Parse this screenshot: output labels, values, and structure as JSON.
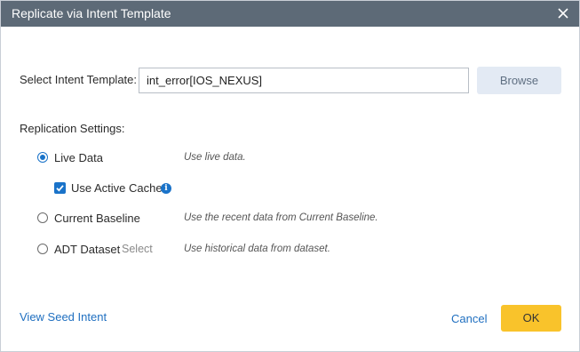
{
  "dialog": {
    "title": "Replicate via Intent Template",
    "close_icon": "close-icon"
  },
  "template": {
    "label": "Select Intent Template:",
    "value": "int_error[IOS_NEXUS]",
    "browse_label": "Browse"
  },
  "replication": {
    "heading": "Replication Settings:",
    "options": [
      {
        "label": "Live Data",
        "description": "Use live data.",
        "selected": true
      },
      {
        "label": "Current Baseline",
        "description": "Use the recent data from Current Baseline.",
        "selected": false
      },
      {
        "label": "ADT Dataset",
        "select_label": "Select",
        "description": "Use historical data from dataset.",
        "selected": false
      }
    ],
    "cache": {
      "label": "Use Active Cache",
      "checked": true,
      "info_icon": "info-icon"
    }
  },
  "footer": {
    "seed_link": "View Seed Intent",
    "cancel_label": "Cancel",
    "ok_label": "OK"
  },
  "colors": {
    "titlebar": "#5d6a77",
    "accent": "#1a73c9",
    "ok_button": "#f9c32b",
    "browse_button": "#e3eaf4"
  }
}
